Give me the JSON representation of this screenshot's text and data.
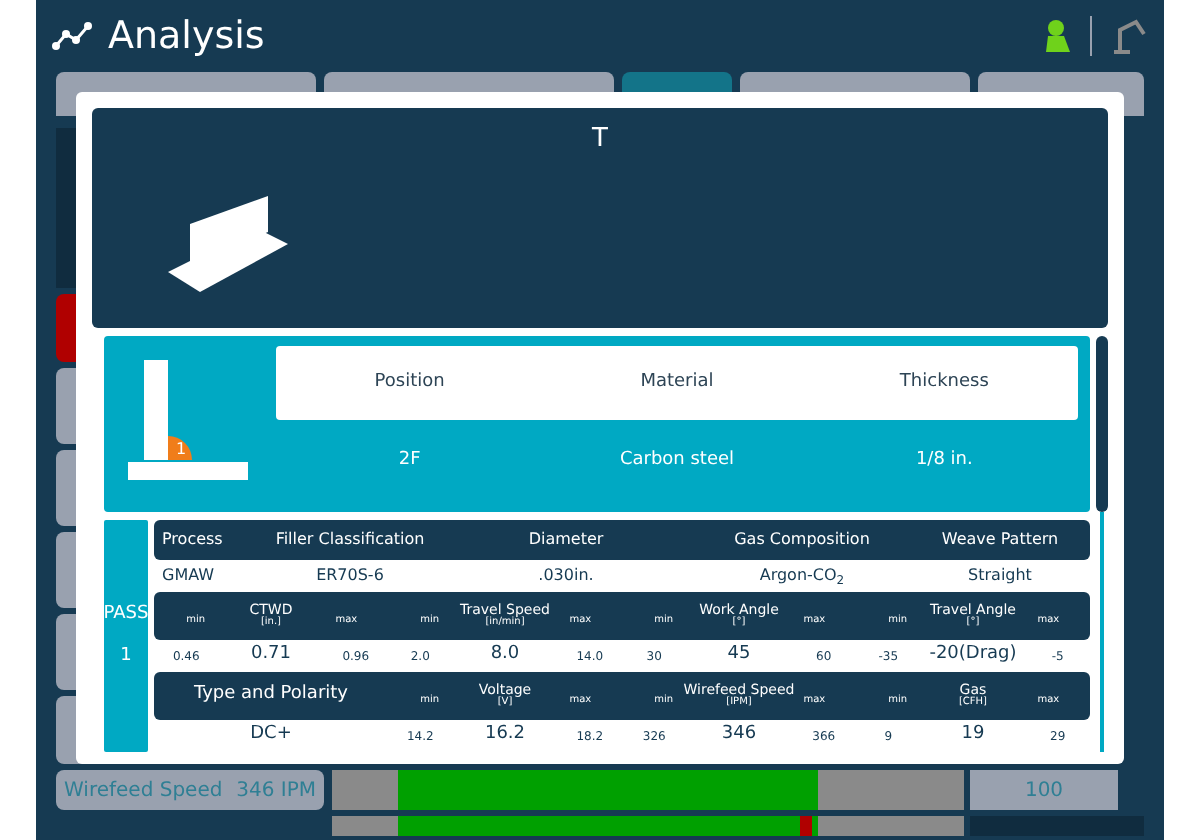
{
  "header": {
    "title": "Analysis"
  },
  "tabs": [
    {
      "selected": false
    },
    {
      "selected": false
    },
    {
      "selected": true
    },
    {
      "selected": false
    },
    {
      "selected": false
    }
  ],
  "modal": {
    "title": "T",
    "marker": "1",
    "specs": [
      {
        "label": "Position",
        "value": "2F"
      },
      {
        "label": "Material",
        "value": "Carbon steel"
      },
      {
        "label": "Thickness",
        "value": "1/8 in."
      }
    ],
    "pass": {
      "label": "PASS",
      "number": "1",
      "process_columns": [
        {
          "label": "Process",
          "value": "GMAW"
        },
        {
          "label": "Filler Classification",
          "value": "ER70S-6"
        },
        {
          "label": "Diameter",
          "value": ".030in."
        },
        {
          "label": "Gas Composition",
          "value": "Argon-CO$_{2}$"
        },
        {
          "label": "Weave Pattern",
          "value": "Straight"
        }
      ],
      "ranges": [
        {
          "name": "CTWD",
          "unit": "[in.]",
          "min_label": "min",
          "max_label": "max",
          "min": "0.46",
          "value": "0.71",
          "max": "0.96"
        },
        {
          "name": "Travel Speed",
          "unit": "[in/min]",
          "min_label": "min",
          "max_label": "max",
          "min": "2.0",
          "value": "8.0",
          "max": "14.0"
        },
        {
          "name": "Work Angle",
          "unit": "[°]",
          "min_label": "min",
          "max_label": "max",
          "min": "30",
          "value": "45",
          "max": "60"
        },
        {
          "name": "Travel Angle",
          "unit": "[°]",
          "min_label": "min",
          "max_label": "max",
          "min": "-35",
          "value": "-20(Drag)",
          "max": "-5"
        }
      ],
      "type_label": "Type and Polarity",
      "type_value": "DC+",
      "electrical": [
        {
          "name": "Voltage",
          "unit": "[V]",
          "min_label": "min",
          "max_label": "max",
          "min": "14.2",
          "value": "16.2",
          "max": "18.2"
        },
        {
          "name": "Wirefeed Speed",
          "unit": "[IPM]",
          "min_label": "min",
          "max_label": "max",
          "min": "326",
          "value": "346",
          "max": "366"
        },
        {
          "name": "Gas",
          "unit": "[CFH]",
          "min_label": "min",
          "max_label": "max",
          "min": "9",
          "value": "19",
          "max": "29"
        }
      ]
    }
  },
  "readout": {
    "label": "Wirefeed Speed",
    "value": "346 IPM",
    "setting": "100"
  }
}
